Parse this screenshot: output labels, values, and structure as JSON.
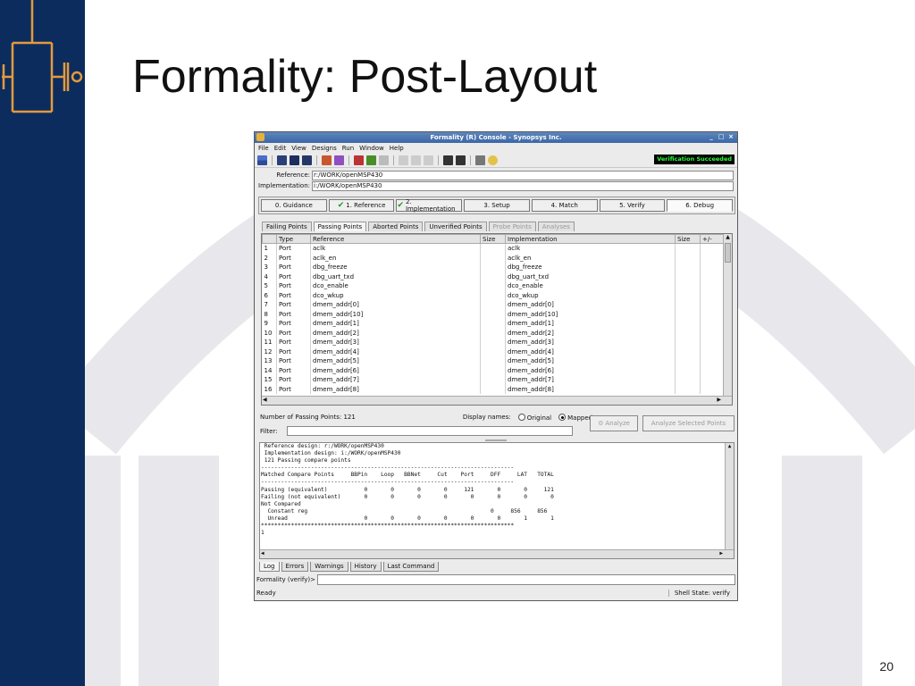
{
  "slide": {
    "title": "Formality: Post-Layout",
    "page_number": "20",
    "colors": {
      "side_bar": "#0c2c5e",
      "accent": "#e49a3c"
    }
  },
  "window": {
    "title": "Formality (R) Console - Synopsys Inc.",
    "menu": [
      "File",
      "Edit",
      "View",
      "Designs",
      "Run",
      "Window",
      "Help"
    ],
    "status_banner": "Verification Succeeded",
    "reference_label": "Reference:",
    "reference_value": "r:/WORK/openMSP430",
    "implementation_label": "Implementation:",
    "implementation_value": "i:/WORK/openMSP430",
    "steps": [
      {
        "label": "0. Guidance",
        "checked": false
      },
      {
        "label": "1. Reference",
        "checked": true
      },
      {
        "label": "2. Implementation",
        "checked": true
      },
      {
        "label": "3. Setup",
        "checked": false
      },
      {
        "label": "4. Match",
        "checked": false
      },
      {
        "label": "5. Verify",
        "checked": false
      },
      {
        "label": "6. Debug",
        "checked": false
      }
    ],
    "subtabs": [
      "Failing Points",
      "Passing Points",
      "Aborted Points",
      "Unverified Points",
      "Probe Points",
      "Analyses"
    ],
    "table": {
      "headers": [
        "",
        "Type",
        "Reference",
        "Size",
        "Implementation",
        "Size",
        "+/-"
      ],
      "rows": [
        [
          "1",
          "Port",
          "aclk",
          "",
          "aclk"
        ],
        [
          "2",
          "Port",
          "aclk_en",
          "",
          "aclk_en"
        ],
        [
          "3",
          "Port",
          "dbg_freeze",
          "",
          "dbg_freeze"
        ],
        [
          "4",
          "Port",
          "dbg_uart_txd",
          "",
          "dbg_uart_txd"
        ],
        [
          "5",
          "Port",
          "dco_enable",
          "",
          "dco_enable"
        ],
        [
          "6",
          "Port",
          "dco_wkup",
          "",
          "dco_wkup"
        ],
        [
          "7",
          "Port",
          "dmem_addr[0]",
          "",
          "dmem_addr[0]"
        ],
        [
          "8",
          "Port",
          "dmem_addr[10]",
          "",
          "dmem_addr[10]"
        ],
        [
          "9",
          "Port",
          "dmem_addr[1]",
          "",
          "dmem_addr[1]"
        ],
        [
          "10",
          "Port",
          "dmem_addr[2]",
          "",
          "dmem_addr[2]"
        ],
        [
          "11",
          "Port",
          "dmem_addr[3]",
          "",
          "dmem_addr[3]"
        ],
        [
          "12",
          "Port",
          "dmem_addr[4]",
          "",
          "dmem_addr[4]"
        ],
        [
          "13",
          "Port",
          "dmem_addr[5]",
          "",
          "dmem_addr[5]"
        ],
        [
          "14",
          "Port",
          "dmem_addr[6]",
          "",
          "dmem_addr[6]"
        ],
        [
          "15",
          "Port",
          "dmem_addr[7]",
          "",
          "dmem_addr[7]"
        ],
        [
          "16",
          "Port",
          "dmem_addr[8]",
          "",
          "dmem_addr[8]"
        ]
      ]
    },
    "count_label": "Number of Passing Points: 121",
    "display_names_label": "Display names:",
    "display_options": [
      "Original",
      "Mapped"
    ],
    "display_selected": "Mapped",
    "analyze_label": "Analyze",
    "analyze_selected_label": "Analyze Selected Points",
    "filter_label": "Filter:",
    "log_lines": [
      " Reference design: r:/WORK/openMSP430",
      " Implementation design: i:/WORK/openMSP430",
      " 121 Passing compare points",
      "----------------------------------------------------------------------------",
      "Matched Compare Points     BBPin    Loop   BBNet     Cut    Port     DFF     LAT   TOTAL",
      "----------------------------------------------------------------------------",
      "Passing (equivalent)           0       0       0       0     121       0       0     121",
      "Failing (not equivalent)       0       0       0       0       0       0       0       0",
      "Not Compared",
      "  Constant reg                                                       0     856     856",
      "  Unread                       0       0       0       0       0       0       1       1",
      "****************************************************************************",
      "1"
    ],
    "log_tabs": [
      "Log",
      "Errors",
      "Warnings",
      "History",
      "Last Command"
    ],
    "prompt": "Formality (verify)>",
    "status_left": "Ready",
    "status_right": "Shell State: verify"
  }
}
